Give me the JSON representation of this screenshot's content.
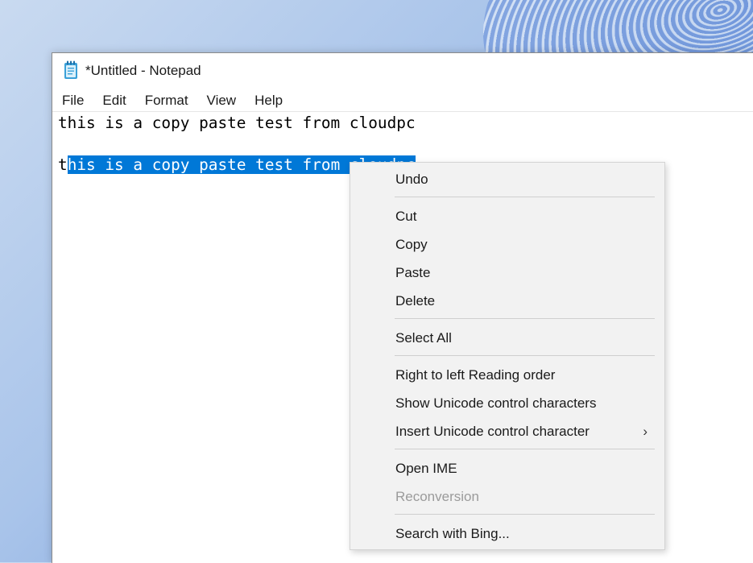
{
  "window": {
    "title": "*Untitled - Notepad"
  },
  "menubar": {
    "items": [
      "File",
      "Edit",
      "Format",
      "View",
      "Help"
    ]
  },
  "editor": {
    "line1": "this is a copy paste test from cloudpc",
    "line2_unselected": "t",
    "line2_selected": "his is a copy paste test from cloudpc"
  },
  "context_menu": {
    "undo": "Undo",
    "cut": "Cut",
    "copy": "Copy",
    "paste": "Paste",
    "delete": "Delete",
    "select_all": "Select All",
    "rtl": "Right to left Reading order",
    "show_unicode": "Show Unicode control characters",
    "insert_unicode": "Insert Unicode control character",
    "submenu_arrow": "›",
    "open_ime": "Open IME",
    "reconversion": "Reconversion",
    "search_bing": "Search with Bing..."
  },
  "colors": {
    "selection": "#0078d7",
    "menu_background": "#f2f2f2",
    "disabled_text": "#9b9b9b"
  },
  "icons": {
    "app": "notepad-icon",
    "submenu": "chevron-right-icon"
  }
}
